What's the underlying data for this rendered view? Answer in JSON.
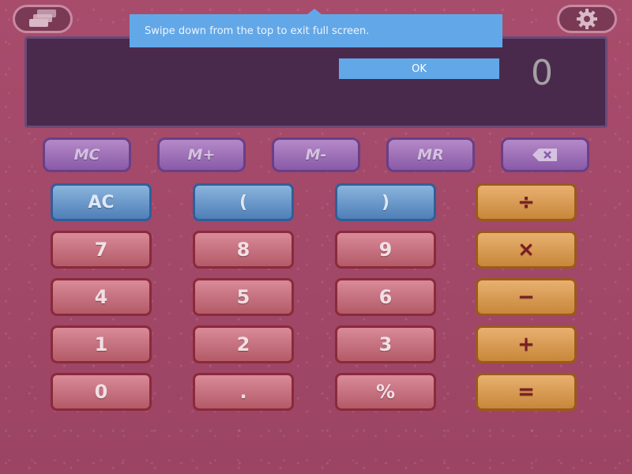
{
  "display": {
    "value": "0"
  },
  "toast": {
    "message": "Swipe down from the top to exit full screen.",
    "ok_label": "OK"
  },
  "top_buttons": {
    "windows_icon": "windows-stack-icon",
    "settings_icon": "gear-icon"
  },
  "memory_keys": [
    "MC",
    "M+",
    "M-",
    "MR"
  ],
  "backspace_icon": "backspace-icon",
  "keys": {
    "ac": "AC",
    "open_paren": "(",
    "close_paren": ")",
    "divide": "÷",
    "multiply": "×",
    "minus": "−",
    "plus": "+",
    "equals": "=",
    "n7": "7",
    "n8": "8",
    "n9": "9",
    "n4": "4",
    "n5": "5",
    "n6": "6",
    "n1": "1",
    "n2": "2",
    "n3": "3",
    "n0": "0",
    "dot": ".",
    "percent": "%"
  },
  "colors": {
    "background": "#a44a6a",
    "memory_key": "#8a5aa8",
    "function_key": "#4f7fb8",
    "number_key": "#b45a68",
    "operator_key": "#c8873a",
    "toast": "#62a8e8"
  }
}
